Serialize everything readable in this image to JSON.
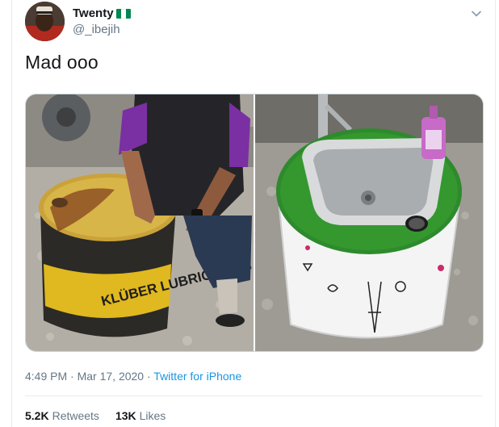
{
  "author": {
    "display_name": "Twenty",
    "handle": "@_ibejih",
    "flag_colors": [
      "#008751",
      "#ffffff",
      "#008751"
    ]
  },
  "tweet": {
    "text": "Mad ooo",
    "time": "4:49 PM",
    "separator": " · ",
    "date": "Mar 17, 2020",
    "source": "Twitter for iPhone"
  },
  "media": {
    "left_photo": {
      "barrel_label": "KLÜBER LUBRICATION"
    },
    "right_photo": {
      "bottle_label": "",
      "watermark": ""
    }
  },
  "stats": {
    "retweets_count": "5.2K",
    "retweets_label": "Retweets",
    "likes_count": "13K",
    "likes_label": "Likes"
  },
  "icons": {
    "caret": "chevron-down-icon"
  }
}
